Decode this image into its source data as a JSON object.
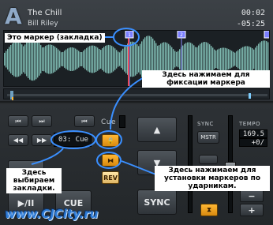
{
  "deck": {
    "letter": "A",
    "title": "The Chill",
    "artist": "Bill Riley",
    "time_elapsed": "00:02",
    "time_remaining": "-05:25"
  },
  "markers": {
    "first": "1",
    "second": "2"
  },
  "transport": {
    "cue_label": "Cue",
    "cue_display": "03: Cue",
    "rev_label": "REV",
    "cue_button": "CUE",
    "play_pause": "▶/II",
    "sync_big": "SYNC",
    "cue_small": "CUE"
  },
  "pitch": {
    "sync_label": "SYNC",
    "tempo_label": "TEMPO",
    "master_label": "MSTR",
    "tempo_value": "169.5",
    "tempo_offset": "+0/",
    "plus": "+",
    "minus": "−"
  },
  "annotations": {
    "marker": "Это маркер (закладка)",
    "lock": "Здесь нажимаем для фиксации маркера",
    "select": "Здесь выбираем закладки.",
    "beat": "Здесь нажимаем для установки маркеров по ударникам."
  },
  "watermark": "www.CJCity.ru",
  "colors": {
    "accent": "#ffb733",
    "wave": "#8fd3c8",
    "annotation_line": "#3a8fff"
  }
}
